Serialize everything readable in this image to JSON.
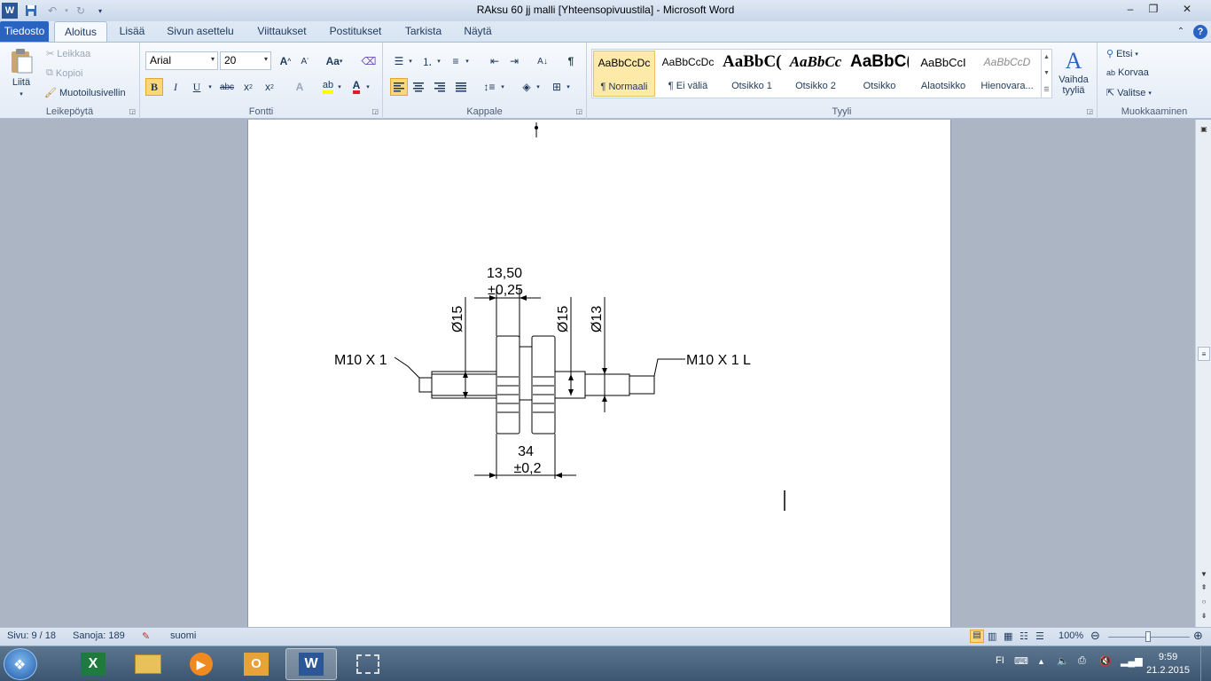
{
  "window": {
    "title": "RAksu 60 jj malli [Yhteensopivuustila]  -  Microsoft Word"
  },
  "tabs": [
    {
      "label": "Tiedosto"
    },
    {
      "label": "Aloitus"
    },
    {
      "label": "Lisää"
    },
    {
      "label": "Sivun asettelu"
    },
    {
      "label": "Viittaukset"
    },
    {
      "label": "Postitukset"
    },
    {
      "label": "Tarkista"
    },
    {
      "label": "Näytä"
    }
  ],
  "ribbon": {
    "clipboard": {
      "paste": "Liitä",
      "cut": "Leikkaa",
      "copy": "Kopioi",
      "format_painter": "Muotoilusivellin",
      "label": "Leikepöytä"
    },
    "font": {
      "name": "Arial",
      "size": "20",
      "label": "Fontti",
      "case_button": "Aa"
    },
    "paragraph": {
      "label": "Kappale"
    },
    "styles": {
      "label": "Tyyli",
      "items": [
        {
          "sample": "AaBbCcDc",
          "name": "¶ Normaali"
        },
        {
          "sample": "AaBbCcDc",
          "name": "¶ Ei väliä"
        },
        {
          "sample": "AaBbC(",
          "name": "Otsikko 1"
        },
        {
          "sample": "AaBbCc",
          "name": "Otsikko 2"
        },
        {
          "sample": "AaBbC(",
          "name": "Otsikko"
        },
        {
          "sample": "AaBbCcI",
          "name": "Alaotsikko"
        },
        {
          "sample": "AaBbCcD",
          "name": "Hienovara..."
        }
      ],
      "change_styles": "Vaihda tyyliä"
    },
    "editing": {
      "label": "Muokkaaminen",
      "find": "Etsi",
      "replace": "Korvaa",
      "select": "Valitse"
    }
  },
  "drawing": {
    "dim_top": "13,50",
    "dim_top_tol": "±0,25",
    "dia_left": "Ø15",
    "dia_mid": "Ø15",
    "dia_right": "Ø13",
    "thread_left": "M10 X 1",
    "thread_right": "M10 X 1 L",
    "dim_bottom": "34",
    "dim_bottom_tol": "±0,2"
  },
  "status": {
    "page": "Sivu: 9 / 18",
    "words": "Sanoja: 189",
    "language": "suomi",
    "zoom": "100%"
  },
  "taskbar": {
    "lang": "FI",
    "time": "9:59",
    "date": "21.2.2015"
  },
  "colors": {
    "file_tab": "#2a64c2",
    "ribbon_bg": "#e3ebf6",
    "doc_bg": "#abb5c3",
    "taskbar": "#4a6580"
  }
}
